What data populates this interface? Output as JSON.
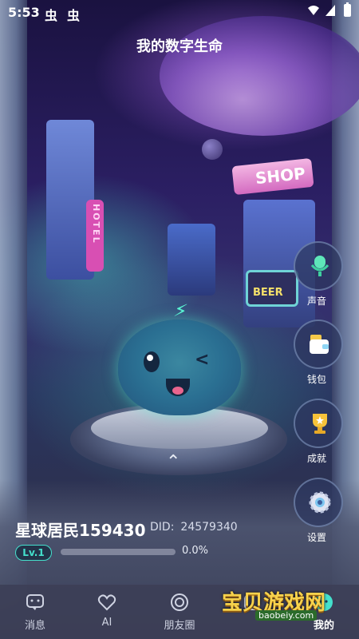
{
  "status_bar": {
    "time": "5:53",
    "notif_glyph_1": "虫",
    "notif_glyph_2": "虫"
  },
  "page": {
    "title": "我的数字生命"
  },
  "scene": {
    "shop_sign": "SHOP",
    "beer_sign": "BEER",
    "hotel_sign": "HOTEL"
  },
  "side_menu": [
    {
      "label": "声音",
      "icon": "microphone-icon"
    },
    {
      "label": "钱包",
      "icon": "wallet-icon"
    },
    {
      "label": "成就",
      "icon": "trophy-icon"
    },
    {
      "label": "设置",
      "icon": "gear-icon"
    }
  ],
  "profile": {
    "username": "星球居民159430",
    "did_label": "DID:",
    "did_value": "24579340",
    "level": "Lv.1",
    "progress_text": "0.0%",
    "progress_fraction": 0
  },
  "bottom_nav": [
    {
      "label": "消息",
      "icon": "message-icon"
    },
    {
      "label": "AI",
      "icon": "heart-icon"
    },
    {
      "label": "朋友圈",
      "icon": "moments-icon"
    },
    {
      "label": "",
      "icon": "square-icon"
    },
    {
      "label": "我的",
      "icon": "profile-icon",
      "active": true
    }
  ],
  "watermark": {
    "text": "宝贝游戏网",
    "url": "baobeiy.com"
  },
  "colors": {
    "accent": "#44e0cc",
    "watermark": "#f7d24c"
  }
}
